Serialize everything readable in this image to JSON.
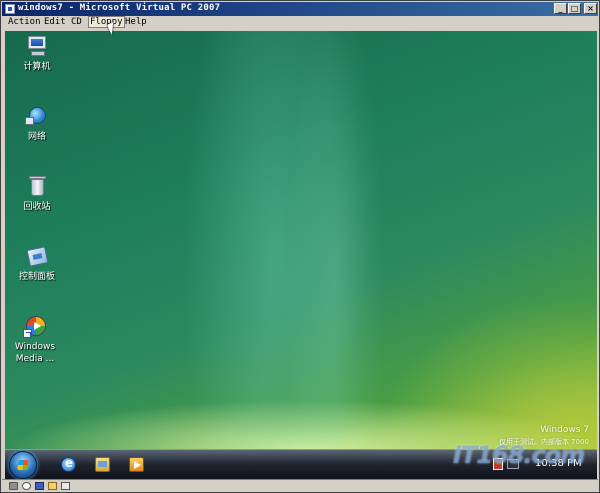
{
  "window": {
    "title": "windows7 - Microsoft Virtual PC 2007",
    "controls": {
      "minimize": "_",
      "maximize": "□",
      "close": "×"
    }
  },
  "menu": [
    {
      "label": "Action"
    },
    {
      "label": "Edit"
    },
    {
      "label": "CD"
    },
    {
      "label": "Floppy",
      "active": true
    },
    {
      "label": "Help"
    }
  ],
  "desktop": {
    "icons": [
      {
        "label": "计算机",
        "icon": "computer-icon"
      },
      {
        "label": "网络",
        "icon": "network-icon"
      },
      {
        "label": "回收站",
        "icon": "recycle-bin-icon"
      },
      {
        "label": "控制面板",
        "icon": "control-panel-icon"
      },
      {
        "label": "Windows",
        "label2": "Media ...",
        "icon": "windows-media-player-icon"
      }
    ],
    "branding": {
      "os": "Windows  7",
      "build": "仅用于测试。内部版本 7000"
    }
  },
  "taskbar": {
    "start": "start-orb-icon",
    "pinned": [
      {
        "icon": "internet-explorer-icon"
      },
      {
        "icon": "windows-explorer-icon"
      },
      {
        "icon": "media-player-icon"
      }
    ],
    "clock": "10:38 PM"
  },
  "watermark": "IT168.com",
  "colors": {
    "titlebar_start": "#0a246a",
    "titlebar_end": "#3a6ea5",
    "chrome": "#d4d0c8",
    "desktop_green": "#1f7e5c",
    "taskbar": "#1f2530"
  }
}
